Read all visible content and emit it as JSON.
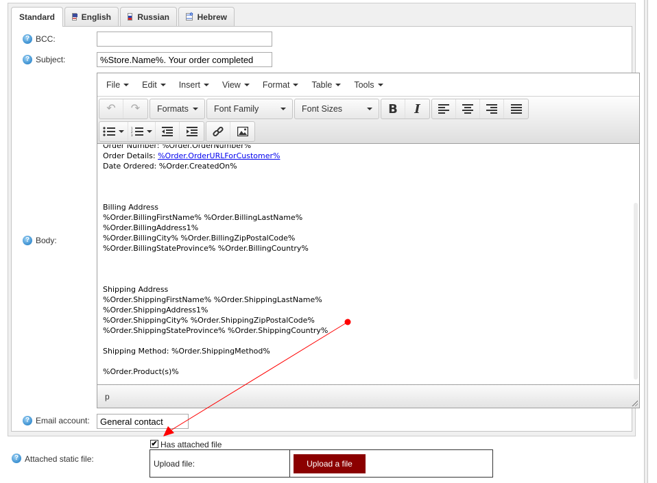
{
  "tabs": [
    {
      "label": "Standard",
      "flag": null,
      "active": true
    },
    {
      "label": "English",
      "flag": "us-flag-icon"
    },
    {
      "label": "Russian",
      "flag": "ru-flag-icon"
    },
    {
      "label": "Hebrew",
      "flag": "il-flag-icon"
    }
  ],
  "form": {
    "bcc": {
      "label": "BCC:",
      "value": ""
    },
    "subject": {
      "label": "Subject:",
      "value": "%Store.Name%. Your order completed"
    },
    "body": {
      "label": "Body:"
    },
    "email_account": {
      "label": "Email account:",
      "value": "General contact"
    },
    "attached_static_file": {
      "label": "Attached static file:"
    }
  },
  "help_icon_glyph": "?",
  "editor": {
    "menu": [
      "File",
      "Edit",
      "Insert",
      "View",
      "Format",
      "Table",
      "Tools"
    ],
    "toolbar": {
      "undo": "↶",
      "redo": "↷",
      "formats": "Formats",
      "font_family": "Font Family",
      "font_sizes": "Font Sizes",
      "bold": "B",
      "italic": "I"
    },
    "content_lines": {
      "l1": "Order Number: %Order.OrderNumber%",
      "l2_prefix": "Order Details: ",
      "l2_link": "%Order.OrderURLForCustomer%",
      "l3": "Date Ordered: %Order.CreatedOn%",
      "billing_title": "Billing Address",
      "b1": "%Order.BillingFirstName% %Order.BillingLastName%",
      "b2": "%Order.BillingAddress1%",
      "b3": "%Order.BillingCity% %Order.BillingZipPostalCode%",
      "b4": "%Order.BillingStateProvince% %Order.BillingCountry%",
      "shipping_title": "Shipping Address",
      "s1": "%Order.ShippingFirstName% %Order.ShippingLastName%",
      "s2": "%Order.ShippingAddress1%",
      "s3": "%Order.ShippingCity% %Order.ShippingZipPostalCode%",
      "s4": "%Order.ShippingStateProvince% %Order.ShippingCountry%",
      "method": "Shipping Method: %Order.ShippingMethod%",
      "products": "%Order.Product(s)%"
    },
    "status_path": "p"
  },
  "attachment": {
    "checkbox_checked": true,
    "checkbox_mark": "✔",
    "checkbox_label": "Has attached file",
    "upload_label": "Upload file:",
    "upload_button": "Upload a file"
  },
  "colors": {
    "upload_button_bg": "#8b0000",
    "annotation_red": "#ff0000",
    "link": "#0000ee"
  }
}
